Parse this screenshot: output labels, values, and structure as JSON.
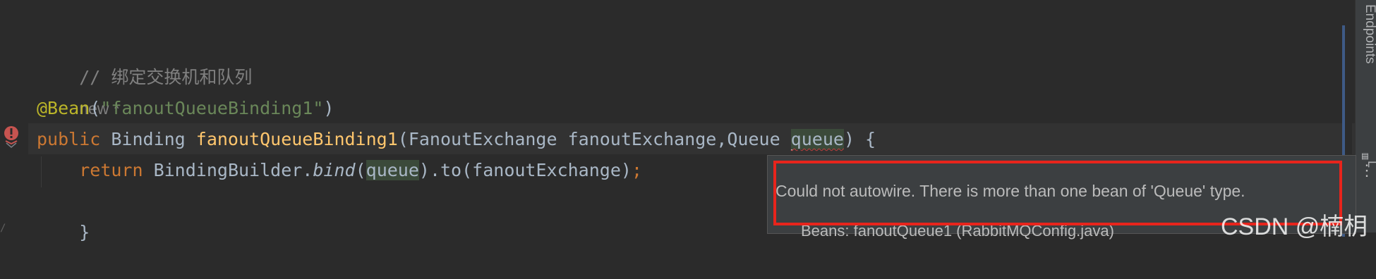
{
  "editor": {
    "lines": {
      "comment": "// 绑定交换机和队列",
      "usage_hint": "new *",
      "annotation": "@Bean",
      "annotation_open": "(",
      "annotation_arg": "\"fanoutQueueBinding1\"",
      "annotation_close": ")",
      "kw_public": "public",
      "return_type": " Binding ",
      "method_name": "fanoutQueueBinding1",
      "params_open": "(FanoutExchange fanoutExchange,",
      "param_type2": "Queue ",
      "param_name2": "queue",
      "params_close": ") {",
      "kw_return": "return",
      "body_call": " BindingBuilder.",
      "bind_method": "bind",
      "bind_open": "(",
      "bind_arg": "queue",
      "bind_rest": ").to(fanoutExchange)",
      "semicolon": ";",
      "closing_brace": "}"
    },
    "gutter_icons": [
      "error-bean-icon",
      "fold-icon"
    ]
  },
  "popup": {
    "message": "Could not autowire. There is more than one bean of 'Queue' type.",
    "next_line": "Beans: fanoutQueue1 (RabbitMQConfig.java)",
    "more_icon": "more-vertical-icon"
  },
  "right_panel": {
    "tab_endpoints": "Endpoints",
    "tab2_label": "L"
  },
  "watermark": "CSDN @楠枂",
  "colors": {
    "background": "#2b2b2b",
    "keyword": "#cc7832",
    "method": "#ffc66d",
    "string": "#6a8759",
    "annotation": "#bbb529",
    "error": "#e8241c"
  }
}
